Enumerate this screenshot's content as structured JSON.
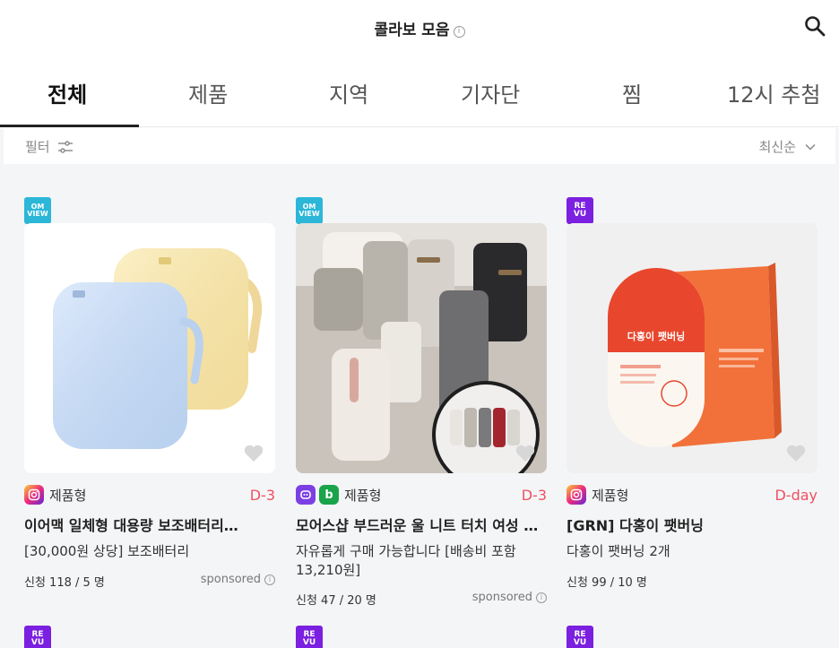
{
  "header": {
    "title": "콜라보 모음",
    "info_glyph": "i",
    "search_icon": "search-icon"
  },
  "tabs": [
    {
      "label": "전체",
      "active": true
    },
    {
      "label": "제품",
      "active": false
    },
    {
      "label": "지역",
      "active": false
    },
    {
      "label": "기자단",
      "active": false
    },
    {
      "label": "찜",
      "active": false
    },
    {
      "label": "12시 추첨",
      "active": false
    }
  ],
  "filterbar": {
    "filter_label": "필터",
    "filter_icon": "sliders-icon",
    "sort_label": "최신순",
    "sort_icon": "chevron-down-icon"
  },
  "cards": [
    {
      "platform_logo": "OM VIEW",
      "platform_logo_lines": [
        "OM",
        "VIEW"
      ],
      "sns": [
        "instagram"
      ],
      "type": "제품형",
      "dday": "D-3",
      "title": "이어맥 일체형 대용량 보조배터리…",
      "desc": "[30,000원 상당] 보조배터리",
      "apply": "신청 118 / 5 명",
      "sponsored": "sponsored",
      "favorited": false,
      "image": "pastel power banks"
    },
    {
      "platform_logo": "OM VIEW",
      "platform_logo_lines": [
        "OM",
        "VIEW"
      ],
      "sns": [
        "naver",
        "blog"
      ],
      "sns_glyphs": [
        "",
        "b"
      ],
      "type": "제품형",
      "dday": "D-3",
      "title": "모어스샵 부드러운 울 니트 터치 여성 장갑",
      "desc": "자유롭게 구매 가능합니다 [배송비 포함 13,210원]",
      "apply": "신청 47 / 20 명",
      "sponsored": "sponsored",
      "favorited": false,
      "image": "knit gloves"
    },
    {
      "platform_logo": "RE VU",
      "platform_logo_lines": [
        "RE",
        "VU"
      ],
      "sns": [
        "instagram"
      ],
      "type": "제품형",
      "dday": "D-day",
      "title": "[GRN] 다홍이 팻버닝",
      "desc": "다홍이 팻버닝 2개",
      "apply": "신청 99 / 10 명",
      "favorited": false,
      "image": "supplement box",
      "product_text": "다홍이 팻버닝"
    }
  ],
  "next_row_logos": [
    "RE VU",
    "RE VU",
    "RE VU"
  ],
  "colors": {
    "accent_red": "#ef5060",
    "omview": "#2cb6d8",
    "revu": "#7b1fe0",
    "blog_green": "#19a34a"
  }
}
